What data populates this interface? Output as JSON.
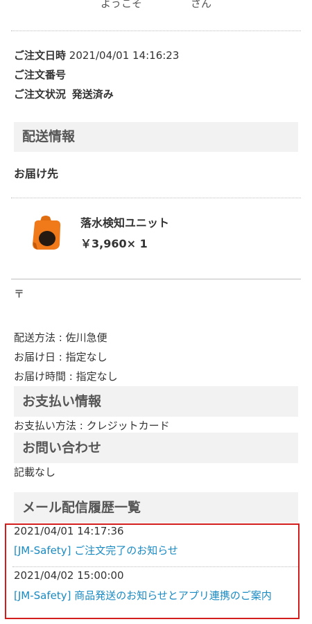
{
  "header": {
    "welcome_prefix": "ようこそ",
    "welcome_suffix": "さん"
  },
  "order": {
    "date_label": "ご注文日時",
    "date_value": "2021/04/01 14:16:23",
    "number_label": "ご注文番号",
    "status_label": "ご注文状況",
    "status_value": "発送済み"
  },
  "shipping": {
    "section_title": "配送情報",
    "destination_label": "お届け先",
    "product_name": "落水検知ユニット",
    "product_price": "￥3,960× 1",
    "postal_mark": "〒",
    "method": "配送方法 : 佐川急便",
    "delivery_date": "お届け日 : 指定なし",
    "delivery_time": "お届け時間 : 指定なし"
  },
  "payment": {
    "section_title": "お支払い情報",
    "method": "お支払い方法 : クレジットカード"
  },
  "inquiry": {
    "section_title": "お問い合わせ",
    "content": "記載なし"
  },
  "mail_history": {
    "section_title": "メール配信履歴一覧",
    "items": [
      {
        "date": "2021/04/01 14:17:36",
        "subject": "[JM-Safety] ご注文完了のお知らせ"
      },
      {
        "date": "2021/04/02 15:00:00",
        "subject": "[JM-Safety] 商品発送のお知らせとアプリ連携のご案内"
      }
    ]
  },
  "colors": {
    "link": "#1a8ac2",
    "highlight_border": "#d31c1c",
    "section_bg": "#f2f2f2",
    "product_orange": "#f07a1a"
  }
}
